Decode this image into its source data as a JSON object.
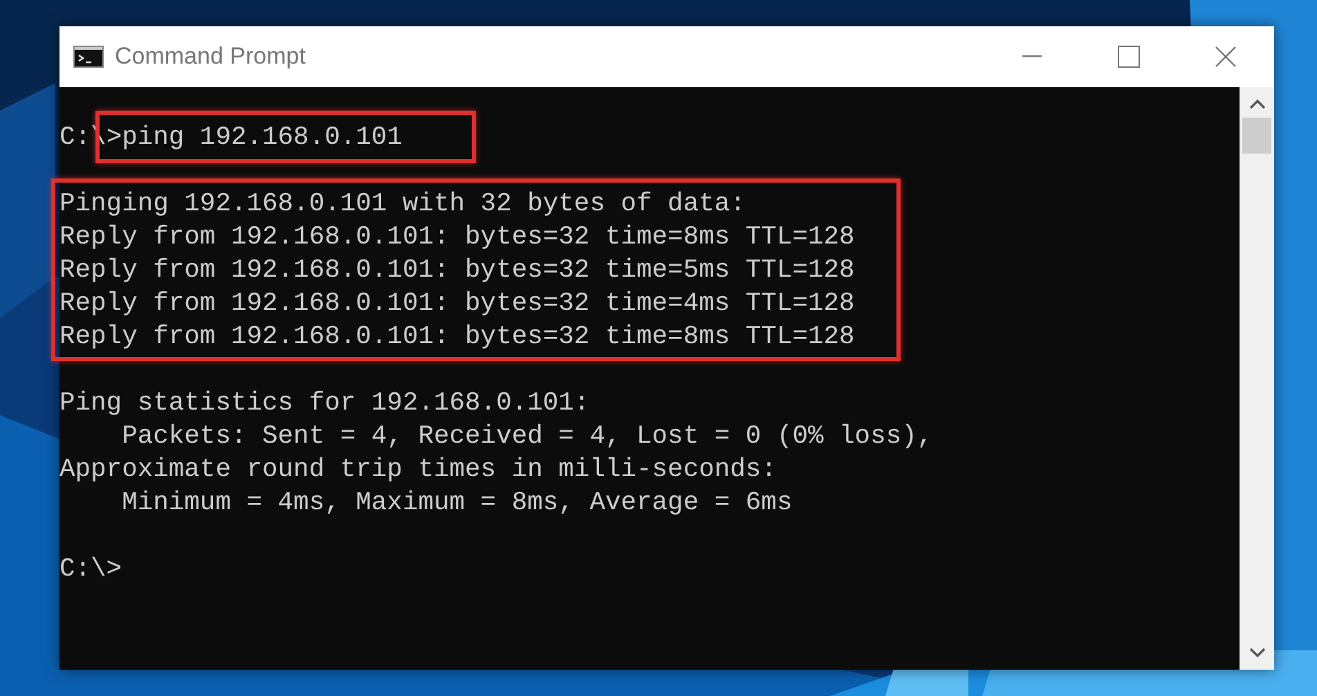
{
  "window": {
    "title": "Command Prompt"
  },
  "console": {
    "command_line": {
      "prompt": "C:\\",
      "command": ">ping 192.168.0.101",
      "highlighted": true
    },
    "blocks": [
      {
        "highlighted": true,
        "lines": [
          "Pinging 192.168.0.101 with 32 bytes of data:",
          "Reply from 192.168.0.101: bytes=32 time=8ms TTL=128",
          "Reply from 192.168.0.101: bytes=32 time=5ms TTL=128",
          "Reply from 192.168.0.101: bytes=32 time=4ms TTL=128",
          "Reply from 192.168.0.101: bytes=32 time=8ms TTL=128"
        ]
      },
      {
        "highlighted": false,
        "lines": [
          "Ping statistics for 192.168.0.101:",
          "    Packets: Sent = 4, Received = 4, Lost = 0 (0% loss),",
          "Approximate round trip times in milli-seconds:",
          "    Minimum = 4ms, Maximum = 8ms, Average = 6ms"
        ]
      },
      {
        "highlighted": false,
        "lines": [
          "C:\\>"
        ]
      }
    ]
  }
}
